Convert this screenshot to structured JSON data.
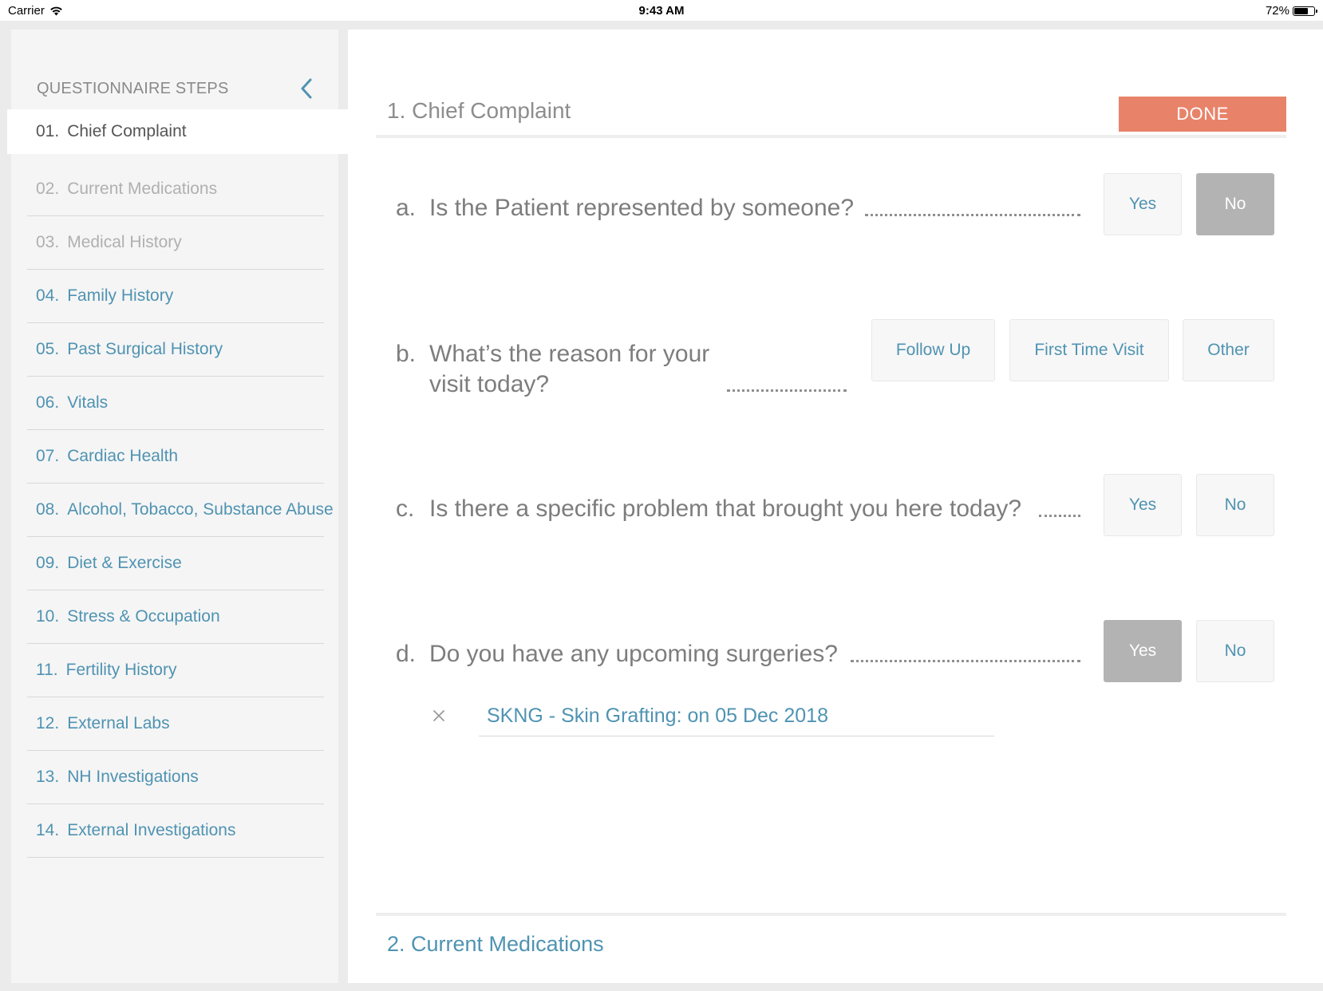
{
  "status_bar": {
    "carrier": "Carrier",
    "time": "9:43 AM",
    "battery": "72%",
    "battery_level": 0.72
  },
  "sidebar": {
    "title": "QUESTIONNAIRE STEPS",
    "steps": [
      {
        "num": "01.",
        "label": "Chief Complaint",
        "state": "active"
      },
      {
        "num": "02.",
        "label": "Current Medications",
        "state": "visited"
      },
      {
        "num": "03.",
        "label": "Medical History",
        "state": "visited"
      },
      {
        "num": "04.",
        "label": "Family History",
        "state": "pending"
      },
      {
        "num": "05.",
        "label": "Past Surgical History",
        "state": "pending"
      },
      {
        "num": "06.",
        "label": "Vitals",
        "state": "pending"
      },
      {
        "num": "07.",
        "label": "Cardiac Health",
        "state": "pending"
      },
      {
        "num": "08.",
        "label": "Alcohol, Tobacco, Substance Abuse",
        "state": "pending"
      },
      {
        "num": "09.",
        "label": "Diet & Exercise",
        "state": "pending"
      },
      {
        "num": "10.",
        "label": "Stress & Occupation",
        "state": "pending"
      },
      {
        "num": "11.",
        "label": "Fertility History",
        "state": "pending"
      },
      {
        "num": "12.",
        "label": "External Labs",
        "state": "pending"
      },
      {
        "num": "13.",
        "label": "NH Investigations",
        "state": "pending"
      },
      {
        "num": "14.",
        "label": "External Investigations",
        "state": "pending"
      }
    ]
  },
  "main": {
    "section_title": "1. Chief Complaint",
    "done_label": "DONE",
    "questions": [
      {
        "letter": "a.",
        "text": "Is the Patient represented by someone?",
        "options": [
          "Yes",
          "No"
        ],
        "selected": "No"
      },
      {
        "letter": "b.",
        "text_line1": "What’s the reason for your",
        "text_line2": "visit today?",
        "options": [
          "Follow Up",
          "First Time Visit",
          "Other"
        ],
        "selected": null
      },
      {
        "letter": "c.",
        "text": "Is there a specific problem that brought you here today?",
        "options": [
          "Yes",
          "No"
        ],
        "selected": null
      },
      {
        "letter": "d.",
        "text": "Do you have any upcoming surgeries?",
        "options": [
          "Yes",
          "No"
        ],
        "selected": "Yes"
      }
    ],
    "surgery_entry": "SKNG - Skin Grafting: on 05 Dec 2018",
    "next_section_title": "2. Current Medications"
  },
  "colors": {
    "accent": "#4f93b2",
    "done": "#e8836a",
    "selected_option": "#b3b3b3",
    "sidebar_bg": "#f5f5f5"
  },
  "icons": [
    "wifi-icon",
    "battery-icon",
    "chevron-left-icon",
    "close-icon"
  ]
}
